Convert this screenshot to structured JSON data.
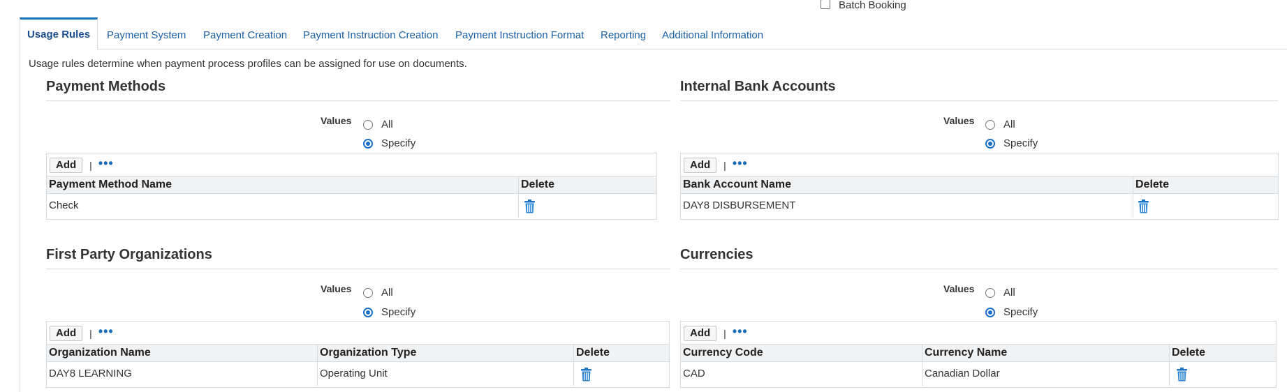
{
  "header": {
    "batch_booking_label": "Batch Booking"
  },
  "tabs": [
    {
      "label": "Usage Rules",
      "active": true
    },
    {
      "label": "Payment System"
    },
    {
      "label": "Payment Creation"
    },
    {
      "label": "Payment Instruction Creation"
    },
    {
      "label": "Payment Instruction Format"
    },
    {
      "label": "Reporting"
    },
    {
      "label": "Additional Information"
    }
  ],
  "description": "Usage rules determine when payment process profiles can be assigned for use on documents.",
  "common": {
    "values_label": "Values",
    "option_all": "All",
    "option_specify": "Specify",
    "add_label": "Add",
    "separator": "|",
    "more_label": "•••",
    "selected_option": "Specify"
  },
  "sections": {
    "payment_methods": {
      "title": "Payment Methods",
      "columns": [
        "Payment Method Name",
        "Delete"
      ],
      "rows": [
        [
          "Check"
        ]
      ]
    },
    "internal_bank_accounts": {
      "title": "Internal Bank Accounts",
      "columns": [
        "Bank Account Name",
        "Delete"
      ],
      "rows": [
        [
          "DAY8 DISBURSEMENT"
        ]
      ]
    },
    "first_party_organizations": {
      "title": "First Party Organizations",
      "columns": [
        "Organization Name",
        "Organization Type",
        "Delete"
      ],
      "rows": [
        [
          "DAY8 LEARNING",
          "Operating Unit"
        ]
      ]
    },
    "currencies": {
      "title": "Currencies",
      "columns": [
        "Currency Code",
        "Currency Name",
        "Delete"
      ],
      "rows": [
        [
          "CAD",
          "Canadian Dollar"
        ]
      ]
    }
  },
  "icons": {
    "delete": "trash-icon",
    "more": "more-actions-icon"
  },
  "colors": {
    "link": "#1a5fa3",
    "accent": "#1a6fb8",
    "header_bg": "#f0f2f4",
    "border": "#d6dbe0"
  }
}
